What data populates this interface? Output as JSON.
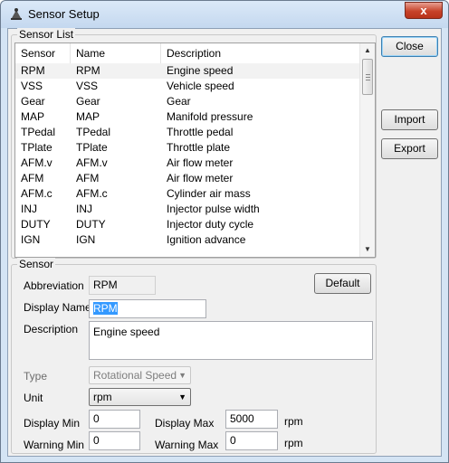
{
  "window": {
    "title": "Sensor Setup",
    "close_glyph": "x"
  },
  "list_group": {
    "label": "Sensor List",
    "columns": [
      "Sensor",
      "Name",
      "Description"
    ],
    "rows": [
      [
        "RPM",
        "RPM",
        "Engine speed"
      ],
      [
        "VSS",
        "VSS",
        "Vehicle speed"
      ],
      [
        "Gear",
        "Gear",
        "Gear"
      ],
      [
        "MAP",
        "MAP",
        "Manifold pressure"
      ],
      [
        "TPedal",
        "TPedal",
        "Throttle pedal"
      ],
      [
        "TPlate",
        "TPlate",
        "Throttle plate"
      ],
      [
        "AFM.v",
        "AFM.v",
        "Air flow meter"
      ],
      [
        "AFM",
        "AFM",
        "Air flow meter"
      ],
      [
        "AFM.c",
        "AFM.c",
        "Cylinder air mass"
      ],
      [
        "INJ",
        "INJ",
        "Injector pulse width"
      ],
      [
        "DUTY",
        "DUTY",
        "Injector duty cycle"
      ],
      [
        "IGN",
        "IGN",
        "Ignition advance"
      ]
    ],
    "selected_row": 0
  },
  "buttons": {
    "close": "Close",
    "import": "Import",
    "export": "Export",
    "default": "Default"
  },
  "sensor_group": {
    "label": "Sensor",
    "abbreviation_label": "Abbreviation",
    "abbreviation_value": "RPM",
    "display_name_label": "Display Name",
    "display_name_value": "RPM",
    "description_label": "Description",
    "description_value": "Engine speed",
    "type_label": "Type",
    "type_value": "Rotational Speed",
    "unit_label": "Unit",
    "unit_value": "rpm",
    "display_min_label": "Display Min",
    "display_min_value": "0",
    "display_max_label": "Display Max",
    "display_max_value": "5000",
    "display_max_unit": "rpm",
    "warning_min_label": "Warning Min",
    "warning_min_value": "0",
    "warning_max_label": "Warning Max",
    "warning_max_value": "0",
    "warning_max_unit": "rpm"
  },
  "icons": {
    "title": "sensor-app-icon",
    "dropdown": "chevron-down-icon",
    "scroll_up": "scroll-up-icon",
    "scroll_down": "scroll-down-icon"
  },
  "colors": {
    "selection": "#3399ff",
    "row_highlight": "#f2f2f2",
    "close_button": "#c7432a"
  }
}
